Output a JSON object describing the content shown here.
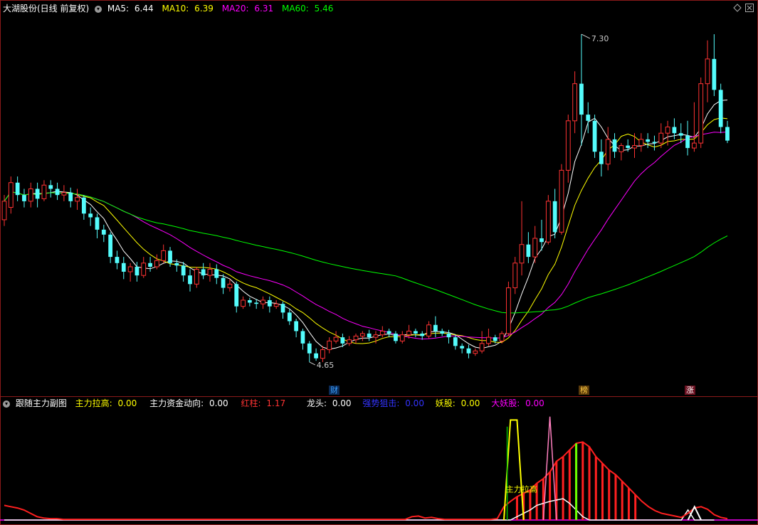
{
  "main_header": {
    "title": "大湖股份(日线 前复权)",
    "ma5": {
      "label": "MA5:",
      "value": "6.44",
      "color": "#ffffff"
    },
    "ma10": {
      "label": "MA10:",
      "value": "6.39",
      "color": "#ffff00"
    },
    "ma20": {
      "label": "MA20:",
      "value": "6.31",
      "color": "#ff00ff"
    },
    "ma60": {
      "label": "MA60:",
      "value": "5.46",
      "color": "#00ff00"
    }
  },
  "annotations": {
    "high": "7.30",
    "low": "4.65"
  },
  "markers": [
    {
      "text": "财",
      "color": "#3aa0ff",
      "bg": "#0b2a55"
    },
    {
      "text": "榜",
      "color": "#ffcc44",
      "bg": "#5a3a0a"
    },
    {
      "text": "涨",
      "color": "#ffffff",
      "bg": "#6a1020"
    }
  ],
  "sub_header": {
    "title": "跟随主力副图",
    "items": [
      {
        "label": "主力拉高:",
        "value": "0.00",
        "color": "#ffff00"
      },
      {
        "label": "主力资金动向:",
        "value": "0.00",
        "color": "#ffffff"
      },
      {
        "label": "红柱:",
        "value": "1.17",
        "color": "#ff3333"
      },
      {
        "label": "龙头:",
        "value": "0.00",
        "color": "#ffffff"
      },
      {
        "label": "强势狙击:",
        "value": "0.00",
        "color": "#3333ff"
      },
      {
        "label": "妖股:",
        "value": "0.00",
        "color": "#ffff00"
      },
      {
        "label": "大妖股:",
        "value": "0.00",
        "color": "#ff00ff"
      }
    ],
    "indicator_text": "主力拉高"
  },
  "colors": {
    "up": "#ff3333",
    "down": "#54fcfc",
    "border": "#8b1a1a",
    "ma5": "#ffffff",
    "ma10": "#ffff00",
    "ma20": "#ff00ff",
    "ma60": "#00ff00"
  },
  "chart_data": [
    {
      "type": "candlestick",
      "ylim": [
        4.5,
        7.45
      ],
      "candles": [
        [
          5.8,
          5.95,
          5.75,
          6.0
        ],
        [
          5.9,
          6.1,
          5.85,
          6.15
        ],
        [
          6.1,
          6.0,
          5.95,
          6.15
        ],
        [
          6.0,
          5.95,
          5.9,
          6.05
        ],
        [
          5.95,
          6.05,
          5.9,
          6.1
        ],
        [
          6.05,
          5.97,
          5.9,
          6.1
        ],
        [
          5.97,
          6.08,
          5.95,
          6.12
        ],
        [
          6.08,
          6.05,
          5.98,
          6.12
        ],
        [
          6.05,
          6.0,
          5.96,
          6.1
        ],
        [
          6.0,
          6.02,
          5.95,
          6.08
        ],
        [
          6.02,
          5.95,
          5.9,
          6.06
        ],
        [
          5.95,
          5.98,
          5.88,
          6.05
        ],
        [
          5.98,
          5.85,
          5.8,
          6.0
        ],
        [
          5.85,
          5.82,
          5.75,
          5.9
        ],
        [
          5.82,
          5.72,
          5.65,
          5.85
        ],
        [
          5.72,
          5.68,
          5.62,
          5.76
        ],
        [
          5.68,
          5.5,
          5.45,
          5.7
        ],
        [
          5.5,
          5.45,
          5.4,
          5.55
        ],
        [
          5.45,
          5.38,
          5.32,
          5.5
        ],
        [
          5.38,
          5.42,
          5.3,
          5.45
        ],
        [
          5.42,
          5.35,
          5.3,
          5.46
        ],
        [
          5.35,
          5.45,
          5.33,
          5.5
        ],
        [
          5.45,
          5.42,
          5.38,
          5.5
        ],
        [
          5.42,
          5.47,
          5.4,
          5.52
        ],
        [
          5.47,
          5.55,
          5.45,
          5.6
        ],
        [
          5.55,
          5.45,
          5.42,
          5.58
        ],
        [
          5.45,
          5.43,
          5.38,
          5.48
        ],
        [
          5.43,
          5.35,
          5.3,
          5.46
        ],
        [
          5.35,
          5.28,
          5.22,
          5.4
        ],
        [
          5.28,
          5.4,
          5.25,
          5.42
        ],
        [
          5.4,
          5.35,
          5.32,
          5.45
        ],
        [
          5.35,
          5.4,
          5.3,
          5.45
        ],
        [
          5.4,
          5.33,
          5.28,
          5.44
        ],
        [
          5.33,
          5.25,
          5.2,
          5.36
        ],
        [
          5.25,
          5.28,
          5.22,
          5.32
        ],
        [
          5.28,
          5.1,
          5.05,
          5.3
        ],
        [
          5.1,
          5.15,
          5.08,
          5.18
        ],
        [
          5.15,
          5.13,
          5.1,
          5.17
        ],
        [
          5.13,
          5.12,
          5.08,
          5.16
        ],
        [
          5.12,
          5.15,
          5.08,
          5.18
        ],
        [
          5.15,
          5.1,
          5.05,
          5.18
        ],
        [
          5.1,
          5.12,
          5.08,
          5.15
        ],
        [
          5.12,
          5.05,
          5.0,
          5.14
        ],
        [
          5.05,
          4.98,
          4.95,
          5.08
        ],
        [
          4.98,
          4.9,
          4.85,
          5.0
        ],
        [
          4.9,
          4.8,
          4.75,
          4.92
        ],
        [
          4.8,
          4.72,
          4.65,
          4.82
        ],
        [
          4.72,
          4.68,
          4.66,
          4.76
        ],
        [
          4.68,
          4.75,
          4.65,
          4.78
        ],
        [
          4.75,
          4.82,
          4.72,
          4.85
        ],
        [
          4.82,
          4.85,
          4.8,
          4.9
        ],
        [
          4.85,
          4.8,
          4.77,
          4.88
        ],
        [
          4.8,
          4.83,
          4.78,
          4.86
        ],
        [
          4.83,
          4.86,
          4.8,
          4.88
        ],
        [
          4.86,
          4.88,
          4.82,
          4.9
        ],
        [
          4.88,
          4.85,
          4.82,
          4.91
        ],
        [
          4.85,
          4.87,
          4.8,
          4.9
        ],
        [
          4.87,
          4.9,
          4.85,
          4.94
        ],
        [
          4.9,
          4.88,
          4.85,
          4.92
        ],
        [
          4.88,
          4.82,
          4.8,
          4.9
        ],
        [
          4.82,
          4.87,
          4.8,
          4.9
        ],
        [
          4.87,
          4.9,
          4.84,
          4.95
        ],
        [
          4.9,
          4.88,
          4.85,
          4.92
        ],
        [
          4.88,
          4.86,
          4.83,
          4.9
        ],
        [
          4.86,
          4.95,
          4.84,
          4.98
        ],
        [
          4.95,
          4.9,
          4.85,
          5.02
        ],
        [
          4.9,
          4.88,
          4.86,
          4.92
        ],
        [
          4.88,
          4.85,
          4.8,
          4.91
        ],
        [
          4.85,
          4.78,
          4.75,
          4.87
        ],
        [
          4.78,
          4.76,
          4.72,
          4.8
        ],
        [
          4.76,
          4.72,
          4.68,
          4.79
        ],
        [
          4.72,
          4.74,
          4.7,
          4.76
        ],
        [
          4.74,
          4.8,
          4.72,
          4.9
        ],
        [
          4.8,
          4.85,
          4.78,
          4.92
        ],
        [
          4.85,
          4.82,
          4.8,
          4.87
        ],
        [
          4.82,
          4.88,
          4.8,
          4.9
        ],
        [
          4.88,
          5.25,
          4.86,
          5.3
        ],
        [
          5.25,
          5.45,
          5.2,
          5.5
        ],
        [
          5.45,
          5.6,
          5.35,
          5.95
        ],
        [
          5.6,
          5.5,
          5.45,
          5.7
        ],
        [
          5.5,
          5.65,
          5.45,
          5.75
        ],
        [
          5.65,
          5.62,
          5.55,
          5.8
        ],
        [
          5.62,
          5.95,
          5.6,
          6.0
        ],
        [
          5.95,
          5.7,
          5.65,
          6.05
        ],
        [
          5.7,
          6.2,
          5.68,
          6.25
        ],
        [
          6.2,
          6.6,
          6.1,
          6.65
        ],
        [
          6.6,
          6.9,
          6.5,
          7.0
        ],
        [
          6.9,
          6.65,
          6.4,
          7.3
        ],
        [
          6.65,
          6.6,
          6.5,
          6.75
        ],
        [
          6.6,
          6.35,
          6.3,
          6.65
        ],
        [
          6.35,
          6.25,
          6.15,
          6.45
        ],
        [
          6.25,
          6.45,
          6.2,
          6.55
        ],
        [
          6.45,
          6.35,
          6.3,
          6.5
        ],
        [
          6.35,
          6.4,
          6.28,
          6.42
        ],
        [
          6.4,
          6.38,
          6.35,
          6.45
        ],
        [
          6.38,
          6.4,
          6.3,
          6.5
        ],
        [
          6.4,
          6.45,
          6.35,
          6.5
        ],
        [
          6.45,
          6.43,
          6.38,
          6.5
        ],
        [
          6.43,
          6.42,
          6.36,
          6.48
        ],
        [
          6.42,
          6.5,
          6.38,
          6.58
        ],
        [
          6.5,
          6.55,
          6.4,
          6.6
        ],
        [
          6.55,
          6.5,
          6.45,
          6.62
        ],
        [
          6.5,
          6.48,
          6.42,
          6.58
        ],
        [
          6.48,
          6.38,
          6.32,
          6.6
        ],
        [
          6.38,
          6.42,
          6.35,
          6.75
        ],
        [
          6.42,
          6.9,
          6.38,
          6.95
        ],
        [
          6.9,
          7.1,
          6.75,
          7.25
        ],
        [
          7.1,
          6.85,
          6.8,
          7.3
        ],
        [
          6.85,
          6.55,
          6.5,
          6.9
        ],
        [
          6.55,
          6.44,
          6.42,
          6.6
        ]
      ],
      "ma_periods": [
        5,
        10,
        20,
        60
      ],
      "high_label_value": 7.3,
      "low_label_value": 4.65
    },
    {
      "type": "indicator",
      "red_area": [
        0.22,
        0.2,
        0.18,
        0.15,
        0.1,
        0.05,
        0.03,
        0.02,
        0.02,
        0.01,
        0.01,
        0.01,
        0.01,
        0.01,
        0.01,
        0.01,
        0.01,
        0.01,
        0.01,
        0.01,
        0.01,
        0.01,
        0.01,
        0.01,
        0.01,
        0.01,
        0.01,
        0.01,
        0.01,
        0.01,
        0.01,
        0.01,
        0.01,
        0.01,
        0.01,
        0.01,
        0.01,
        0.01,
        0.01,
        0.01,
        0.01,
        0.01,
        0.01,
        0.01,
        0.01,
        0.01,
        0.01,
        0.01,
        0.01,
        0.01,
        0.01,
        0.01,
        0.01,
        0.01,
        0.01,
        0.01,
        0.01,
        0.01,
        0.01,
        0.01,
        0.01,
        0.01,
        0.05,
        0.06,
        0.03,
        0.04,
        0.02,
        0.01,
        0.01,
        0.01,
        0.01,
        0.01,
        0.01,
        0.01,
        0.01,
        0.02,
        0.2,
        0.28,
        0.35,
        0.4,
        0.45,
        0.55,
        0.62,
        0.72,
        0.88,
        0.95,
        1.05,
        1.15,
        1.17,
        1.1,
        0.95,
        0.85,
        0.75,
        0.68,
        0.58,
        0.48,
        0.38,
        0.28,
        0.2,
        0.14,
        0.1,
        0.08,
        0.06,
        0.04,
        0.1,
        0.18,
        0.2,
        0.16,
        0.08,
        0.04,
        0.02
      ],
      "white_area": [
        0,
        0,
        0,
        0,
        0,
        0,
        0,
        0,
        0,
        0,
        0,
        0,
        0,
        0,
        0,
        0,
        0,
        0,
        0,
        0,
        0,
        0,
        0,
        0,
        0,
        0,
        0,
        0,
        0,
        0,
        0,
        0,
        0,
        0,
        0,
        0,
        0,
        0,
        0,
        0,
        0,
        0,
        0,
        0,
        0,
        0,
        0,
        0,
        0,
        0,
        0,
        0,
        0,
        0,
        0,
        0,
        0,
        0,
        0,
        0,
        0,
        0,
        0,
        0,
        0,
        0,
        0,
        0,
        0,
        0,
        0,
        0,
        0,
        0,
        0,
        0,
        0,
        0,
        0.05,
        0.1,
        0.15,
        0.22,
        0.25,
        0.28,
        0.3,
        0.32,
        0.25,
        0.15,
        0.05,
        0,
        0,
        0,
        0,
        0,
        0,
        0,
        0,
        0,
        0,
        0,
        0,
        0,
        0,
        0,
        0.15,
        0,
        0,
        0,
        0
      ],
      "ylim": [
        0,
        1.6
      ]
    }
  ]
}
